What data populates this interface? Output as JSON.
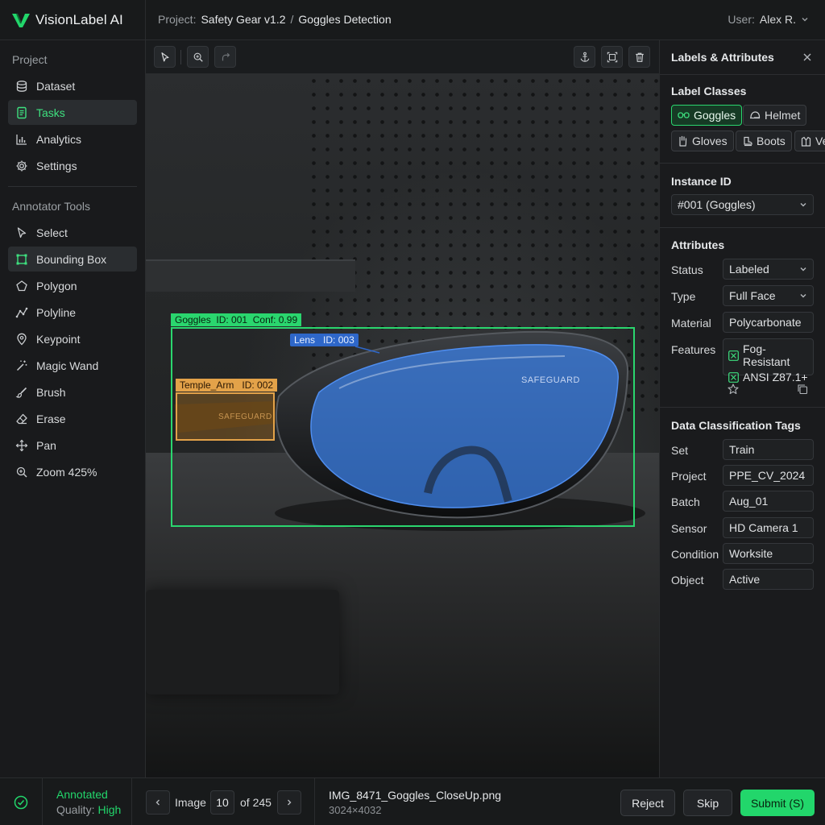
{
  "app": {
    "name": "VisionLabel AI",
    "accent": "#22d66b"
  },
  "breadcrumb": {
    "prefix": "Project:",
    "project": "Safety Gear v1.2",
    "separator": "/",
    "task": "Goggles Detection"
  },
  "user": {
    "label": "User:",
    "name": "Alex R."
  },
  "sidebar": {
    "project_title": "Project",
    "project_items": [
      {
        "label": "Dataset",
        "icon": "database-icon"
      },
      {
        "label": "Tasks",
        "icon": "tasks-icon",
        "active": true
      },
      {
        "label": "Analytics",
        "icon": "chart-icon"
      },
      {
        "label": "Settings",
        "icon": "gear-icon"
      }
    ],
    "tools_title": "Annotator Tools",
    "tools": [
      {
        "label": "Select",
        "icon": "cursor-icon"
      },
      {
        "label": "Bounding Box",
        "icon": "bbox-icon",
        "active": true
      },
      {
        "label": "Polygon",
        "icon": "polygon-icon"
      },
      {
        "label": "Polyline",
        "icon": "polyline-icon"
      },
      {
        "label": "Keypoint",
        "icon": "keypoint-icon"
      },
      {
        "label": "Magic Wand",
        "icon": "magic-wand-icon"
      },
      {
        "label": "Brush",
        "icon": "brush-icon"
      },
      {
        "label": "Erase",
        "icon": "eraser-icon"
      },
      {
        "label": "Pan",
        "icon": "pan-icon"
      },
      {
        "label": "Zoom 425%",
        "icon": "zoom-icon"
      }
    ]
  },
  "annotations": {
    "goggles": {
      "label": "Goggles",
      "id": "ID: 001",
      "conf": "Conf: 0.99",
      "color": "#2ad66e"
    },
    "temple": {
      "label": "Temple_Arm",
      "id": "ID: 002",
      "color": "#e3a249"
    },
    "lens": {
      "label": "Lens",
      "id": "ID: 003",
      "color": "#2e67c9"
    },
    "brand_text": "SAFEGUARD"
  },
  "panel": {
    "title": "Labels & Attributes",
    "label_classes_title": "Label Classes",
    "classes": [
      {
        "label": "Goggles",
        "icon": "goggles-icon",
        "selected": true
      },
      {
        "label": "Helmet",
        "icon": "helmet-icon"
      },
      {
        "label": "Gloves",
        "icon": "glove-icon"
      },
      {
        "label": "Boots",
        "icon": "boot-icon"
      },
      {
        "label": "Ve",
        "icon": "vest-icon"
      }
    ],
    "instance_title": "Instance ID",
    "instance_value": "#001 (Goggles)",
    "attributes_title": "Attributes",
    "attributes": {
      "status": {
        "label": "Status",
        "value": "Labeled"
      },
      "type": {
        "label": "Type",
        "value": "Full Face"
      },
      "material": {
        "label": "Material",
        "value": "Polycarbonate"
      },
      "features": {
        "label": "Features",
        "values": [
          "Fog-Resistant",
          "ANSI Z87.1+"
        ]
      }
    },
    "tags_title": "Data Classification Tags",
    "tags": [
      {
        "label": "Set",
        "value": "Train"
      },
      {
        "label": "Project",
        "value": "PPE_CV_2024"
      },
      {
        "label": "Batch",
        "value": "Aug_01"
      },
      {
        "label": "Sensor",
        "value": "HD Camera 1"
      },
      {
        "label": "Condition",
        "value": "Worksite"
      },
      {
        "label": "Object",
        "value": "Active"
      }
    ]
  },
  "footer": {
    "status": "Annotated",
    "quality_label": "Quality:",
    "quality_value": "High",
    "image_label": "Image",
    "image_index": "10",
    "image_total": "of 245",
    "filename": "IMG_8471_Goggles_CloseUp.png",
    "dimensions": "3024×4032",
    "reject": "Reject",
    "skip": "Skip",
    "submit": "Submit (S)"
  }
}
